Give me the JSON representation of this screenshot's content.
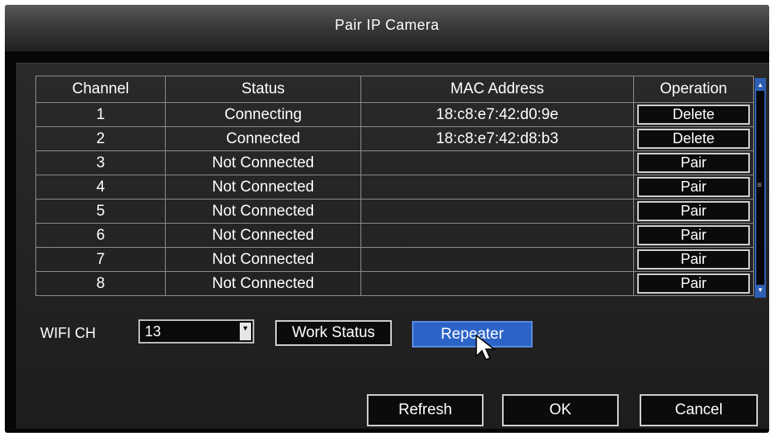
{
  "window": {
    "title": "Pair IP Camera"
  },
  "table": {
    "headers": [
      "Channel",
      "Status",
      "MAC Address",
      "Operation"
    ],
    "rows": [
      {
        "channel": "1",
        "status": "Connecting",
        "mac": "18:c8:e7:42:d0:9e",
        "operation": "Delete"
      },
      {
        "channel": "2",
        "status": "Connected",
        "mac": "18:c8:e7:42:d8:b3",
        "operation": "Delete"
      },
      {
        "channel": "3",
        "status": "Not Connected",
        "mac": "",
        "operation": "Pair"
      },
      {
        "channel": "4",
        "status": "Not Connected",
        "mac": "",
        "operation": "Pair"
      },
      {
        "channel": "5",
        "status": "Not Connected",
        "mac": "",
        "operation": "Pair"
      },
      {
        "channel": "6",
        "status": "Not Connected",
        "mac": "",
        "operation": "Pair"
      },
      {
        "channel": "7",
        "status": "Not Connected",
        "mac": "",
        "operation": "Pair"
      },
      {
        "channel": "8",
        "status": "Not Connected",
        "mac": "",
        "operation": "Pair"
      }
    ]
  },
  "scrollbar": {
    "up_icon": "▲",
    "down_icon": "▼",
    "grip_icon": "≡"
  },
  "wifi": {
    "label": "WIFI CH",
    "selected": "13",
    "dropdown_icon": "▼"
  },
  "buttons": {
    "work_status": "Work Status",
    "repeater": "Repeater",
    "refresh": "Refresh",
    "ok": "OK",
    "cancel": "Cancel"
  },
  "colors": {
    "selected_button": "#2c63c7",
    "scrollbar_accent": "#2d5fb5",
    "background": "#060606"
  }
}
